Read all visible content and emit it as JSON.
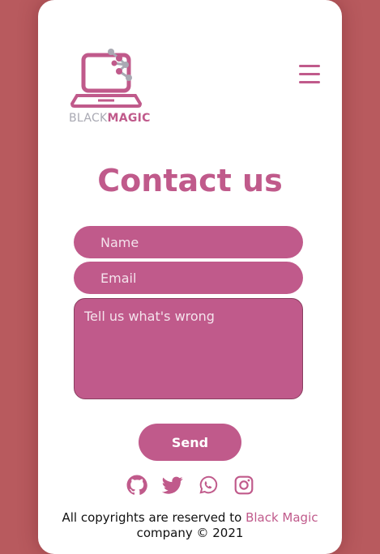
{
  "brand": {
    "logo_text_light": "BLACK",
    "logo_text_bold": "MAGIC"
  },
  "header": {
    "menu_icon": "hamburger-menu-icon"
  },
  "main": {
    "title": "Contact us"
  },
  "form": {
    "name_placeholder": "Name",
    "email_placeholder": "Email",
    "message_placeholder": "Tell us what's wrong",
    "send_label": "Send"
  },
  "socials": [
    {
      "icon": "github-icon"
    },
    {
      "icon": "twitter-icon"
    },
    {
      "icon": "whatsapp-icon"
    },
    {
      "icon": "instagram-icon"
    }
  ],
  "footer": {
    "text_before": "All copyrights are reserved to",
    "brand_link": "Black Magic",
    "text_after": "company © 2021"
  },
  "colors": {
    "background": "#b85a5e",
    "accent": "#c05a8b",
    "card": "#ffffff"
  }
}
